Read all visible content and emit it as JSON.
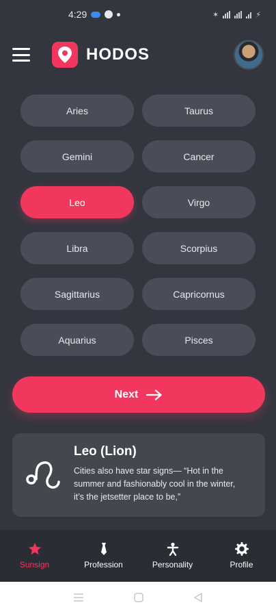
{
  "status_bar": {
    "time": "4:29",
    "right_text": "✶ ≡ ∥∥ ⋮"
  },
  "header": {
    "title": "HODOS",
    "icons": {
      "menu": "menu-icon",
      "logo": "location-pin-icon",
      "avatar": "profile-avatar"
    }
  },
  "signs": [
    {
      "label": "Aries",
      "selected": false
    },
    {
      "label": "Taurus",
      "selected": false
    },
    {
      "label": "Gemini",
      "selected": false
    },
    {
      "label": "Cancer",
      "selected": false
    },
    {
      "label": "Leo",
      "selected": true
    },
    {
      "label": "Virgo",
      "selected": false
    },
    {
      "label": "Libra",
      "selected": false
    },
    {
      "label": "Scorpius",
      "selected": false
    },
    {
      "label": "Sagittarius",
      "selected": false
    },
    {
      "label": "Capricornus",
      "selected": false
    },
    {
      "label": "Aquarius",
      "selected": false
    },
    {
      "label": "Pisces",
      "selected": false
    }
  ],
  "next_button": {
    "label": "Next",
    "icon": "arrow-right-icon"
  },
  "info_card": {
    "title": "Leo (Lion)",
    "description": "Cities also have star signs— “Hot in the summer and fashionably cool in the winter, it’s the jetsetter place to be,”",
    "icon": "leo-symbol-icon"
  },
  "bottom_nav": [
    {
      "label": "Sunsign",
      "icon": "star-icon",
      "active": true
    },
    {
      "label": "Profession",
      "icon": "tie-icon",
      "active": false
    },
    {
      "label": "Personality",
      "icon": "person-icon",
      "active": false
    },
    {
      "label": "Profile",
      "icon": "gear-icon",
      "active": false
    }
  ],
  "colors": {
    "accent": "#f2375f",
    "background": "#34363f",
    "chip": "#4a4c57",
    "card": "#45474f",
    "nav": "#2b2d34"
  }
}
